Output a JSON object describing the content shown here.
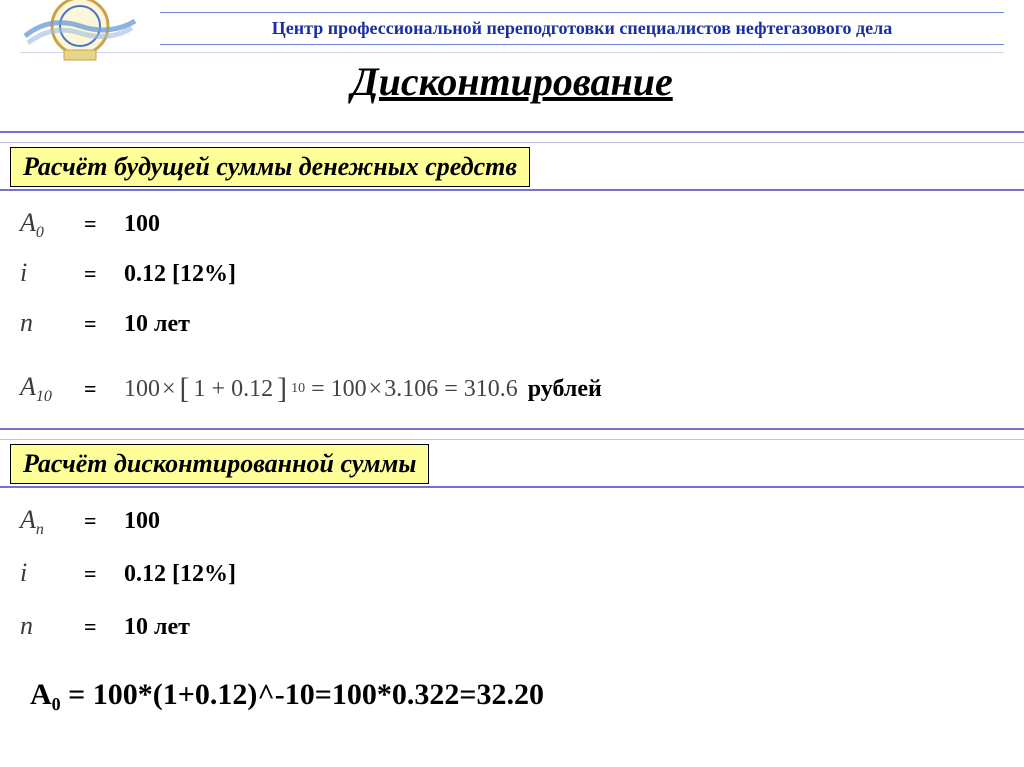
{
  "header": {
    "org": "Центр профессиональной переподготовки специалистов нефтегазового дела"
  },
  "title": "Дисконтирование",
  "section1": {
    "heading": "Расчёт будущей суммы денежных средств",
    "rows": {
      "a0_sym": "A",
      "a0_sub": "0",
      "a0_val": "100",
      "i_sym": "i",
      "i_val": "0.12 [12%]",
      "n_sym": "n",
      "n_val": "10 лет",
      "a10_sym": "A",
      "a10_sub": "10"
    },
    "formula": {
      "p1": "100",
      "times1": "×",
      "lb": "[",
      "inner": "1 + 0.12",
      "rb": "]",
      "exp": "10",
      "eq1": "=",
      "p2": "100",
      "times2": "×",
      "p3": "3.106",
      "eq2": "=",
      "p4": "310.6",
      "suffix": "рублей"
    }
  },
  "section2": {
    "heading": "Расчёт дисконтированной суммы",
    "rows": {
      "an_sym": "A",
      "an_sub": "n",
      "an_val": "100",
      "i_sym": "i",
      "i_val": "0.12 [12%]",
      "n_sym": "n",
      "n_val": "10 лет"
    },
    "final": "A₀ = 100*(1+0.12)^-10=100*0.322=32.20"
  }
}
